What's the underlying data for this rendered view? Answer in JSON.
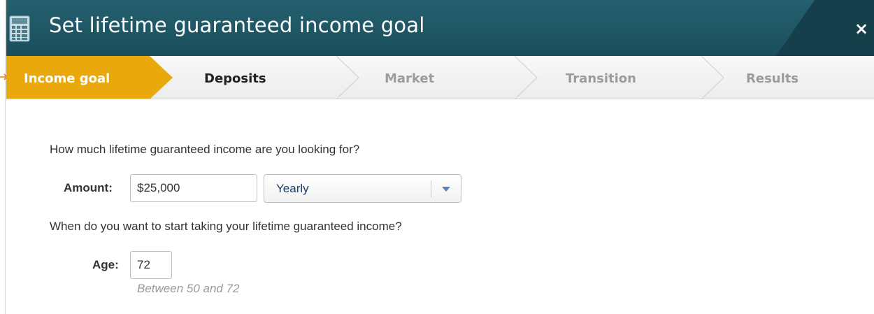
{
  "window": {
    "title": "Set lifetime guaranteed income goal",
    "icon": "calculator-icon",
    "close_label": "×"
  },
  "steps": [
    {
      "label": "Income goal",
      "state": "active"
    },
    {
      "label": "Deposits",
      "state": "enabled"
    },
    {
      "label": "Market",
      "state": "disabled"
    },
    {
      "label": "Transition",
      "state": "disabled"
    },
    {
      "label": "Results",
      "state": "disabled"
    }
  ],
  "form": {
    "income_question": "How much lifetime guaranteed income are you looking for?",
    "amount_label": "Amount:",
    "amount_value": "$25,000",
    "frequency_value": "Yearly",
    "age_question": "When do you want to start taking your lifetime guaranteed income?",
    "age_label": "Age:",
    "age_value": "72",
    "age_hint": "Between 50 and 72"
  },
  "colors": {
    "titlebar": "#1e5563",
    "active_step": "#e9a80c",
    "step_text_enabled": "#222222",
    "step_text_disabled": "#9c9c9c",
    "select_text": "#1c3f6e",
    "pointer": "#d9821a"
  }
}
